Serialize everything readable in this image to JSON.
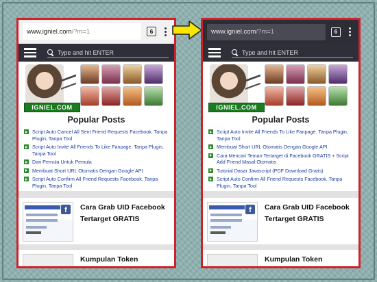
{
  "left_phone": {
    "url_host": "www.igniel.com",
    "url_query": "/?m=1",
    "tab_count": "6",
    "search_placeholder": "Type and hit ENTER",
    "logo_text": "IGNIEL.COM",
    "popular_title": "Popular Posts",
    "posts": [
      "Script Auto Cancel All Sent Friend Requests Facebook. Tanpa Plugin, Tanpa Tool",
      "Script Auto Invite All Friends To Like Fanpage. Tanpa Plugin, Tanpa Tool",
      "Dari Pemula Untuk Pemula",
      "Membuat Short URL Otomatis Dengan Google API",
      "Script Auto Confirm All Friend Requests Facebook. Tanpa Plugin, Tanpa Tool"
    ],
    "card_title": "Cara Grab UID Facebook Tertarget GRATIS",
    "card2_title": "Kumpulan Token Facebook"
  },
  "right_phone": {
    "url_host": "www.igniel.com",
    "url_query": "/?m=1",
    "tab_count": "6",
    "search_placeholder": "Type and hit ENTER",
    "logo_text": "IGNIEL.COM",
    "popular_title": "Popular Posts",
    "posts": [
      "Script Auto Invite All Friends To Like Fanpage. Tanpa Plugin, Tanpa Tool",
      "Membuat Short URL Otomatis Dengan Google API",
      "Cara Mencari Teman Tertarget di Facebook GRATIS + Script Add Friend Masal Otomatis",
      "Tutorial Dasar Javascript (PDF Download Gratis)",
      "Script Auto Confirm All Friend Requests Facebook. Tanpa Plugin, Tanpa Tool"
    ],
    "card_title": "Cara Grab UID Facebook Tertarget GRATIS",
    "card2_title": "Kumpulan Token Facebook"
  },
  "colors": {
    "frame_red": "#d0202a",
    "arrow_yellow": "#f7e600",
    "navbar_dark": "#2e2f38",
    "dark_urlbar": "#2d2d36",
    "link_blue": "#1c3f9a",
    "bullet_green": "#2e8b2e"
  },
  "icons": [
    "hamburger-menu-icon",
    "search-icon",
    "tab-switcher-icon",
    "overflow-menu-icon",
    "arrow-right-icon",
    "facebook-icon"
  ]
}
